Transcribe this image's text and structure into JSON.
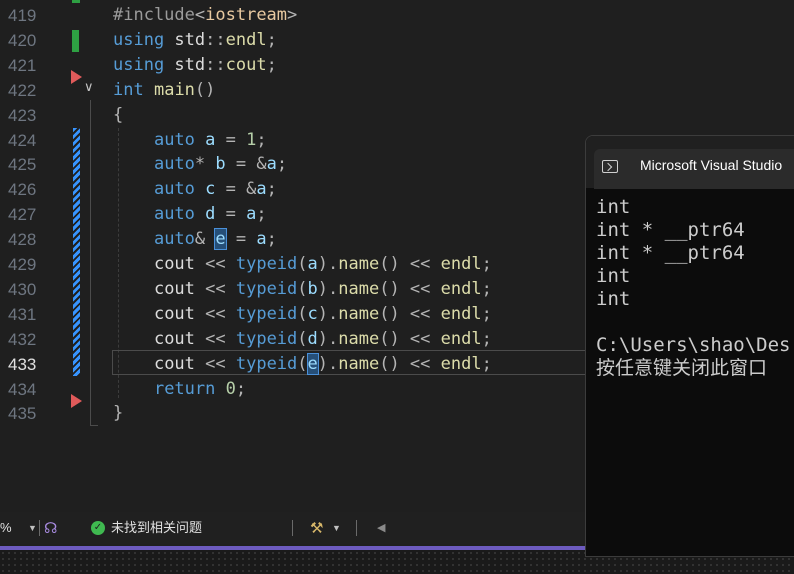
{
  "editor": {
    "lines": [
      {
        "num": "419",
        "tokens": [
          [
            "pp",
            "#include"
          ],
          [
            "op",
            "<"
          ],
          [
            "inc",
            "iostream"
          ],
          [
            "op",
            ">"
          ]
        ]
      },
      {
        "num": "420",
        "tokens": [
          [
            "kw",
            "using"
          ],
          [
            "id",
            " std"
          ],
          [
            "op",
            "::"
          ],
          [
            "fn",
            "endl"
          ],
          [
            "op",
            ";"
          ]
        ]
      },
      {
        "num": "421",
        "tokens": [
          [
            "kw",
            "using"
          ],
          [
            "id",
            " std"
          ],
          [
            "op",
            "::"
          ],
          [
            "fn",
            "cout"
          ],
          [
            "op",
            ";"
          ]
        ]
      },
      {
        "num": "422",
        "tokens": [
          [
            "kw",
            "int"
          ],
          [
            "id",
            " "
          ],
          [
            "fn",
            "main"
          ],
          [
            "op",
            "()"
          ]
        ]
      },
      {
        "num": "423",
        "tokens": [
          [
            "op",
            "{"
          ]
        ]
      },
      {
        "num": "424",
        "tokens": [
          [
            "id",
            "    "
          ],
          [
            "kw",
            "auto"
          ],
          [
            "id",
            " "
          ],
          [
            "var",
            "a"
          ],
          [
            "op",
            " = "
          ],
          [
            "num",
            "1"
          ],
          [
            "op",
            ";"
          ]
        ]
      },
      {
        "num": "425",
        "tokens": [
          [
            "id",
            "    "
          ],
          [
            "kw",
            "auto"
          ],
          [
            "op",
            "*"
          ],
          [
            "id",
            " "
          ],
          [
            "var",
            "b"
          ],
          [
            "op",
            " = &"
          ],
          [
            "var",
            "a"
          ],
          [
            "op",
            ";"
          ]
        ]
      },
      {
        "num": "426",
        "tokens": [
          [
            "id",
            "    "
          ],
          [
            "kw",
            "auto"
          ],
          [
            "id",
            " "
          ],
          [
            "var",
            "c"
          ],
          [
            "op",
            " = &"
          ],
          [
            "var",
            "a"
          ],
          [
            "op",
            ";"
          ]
        ]
      },
      {
        "num": "427",
        "tokens": [
          [
            "id",
            "    "
          ],
          [
            "kw",
            "auto"
          ],
          [
            "id",
            " "
          ],
          [
            "var",
            "d"
          ],
          [
            "op",
            " = "
          ],
          [
            "var",
            "a"
          ],
          [
            "op",
            ";"
          ]
        ]
      },
      {
        "num": "428",
        "tokens": [
          [
            "id",
            "    "
          ],
          [
            "kw",
            "auto"
          ],
          [
            "op",
            "&"
          ],
          [
            "id",
            " "
          ],
          [
            "varhl",
            "e"
          ],
          [
            "op",
            " = "
          ],
          [
            "var",
            "a"
          ],
          [
            "op",
            ";"
          ]
        ]
      },
      {
        "num": "429",
        "tokens": [
          [
            "id",
            "    "
          ],
          [
            "id",
            "cout"
          ],
          [
            "op",
            " << "
          ],
          [
            "kw",
            "typeid"
          ],
          [
            "op",
            "("
          ],
          [
            "var",
            "a"
          ],
          [
            "op",
            ")."
          ],
          [
            "fn",
            "name"
          ],
          [
            "op",
            "() << "
          ],
          [
            "fn",
            "endl"
          ],
          [
            "op",
            ";"
          ]
        ]
      },
      {
        "num": "430",
        "tokens": [
          [
            "id",
            "    "
          ],
          [
            "id",
            "cout"
          ],
          [
            "op",
            " << "
          ],
          [
            "kw",
            "typeid"
          ],
          [
            "op",
            "("
          ],
          [
            "var",
            "b"
          ],
          [
            "op",
            ")."
          ],
          [
            "fn",
            "name"
          ],
          [
            "op",
            "() << "
          ],
          [
            "fn",
            "endl"
          ],
          [
            "op",
            ";"
          ]
        ]
      },
      {
        "num": "431",
        "tokens": [
          [
            "id",
            "    "
          ],
          [
            "id",
            "cout"
          ],
          [
            "op",
            " << "
          ],
          [
            "kw",
            "typeid"
          ],
          [
            "op",
            "("
          ],
          [
            "var",
            "c"
          ],
          [
            "op",
            ")."
          ],
          [
            "fn",
            "name"
          ],
          [
            "op",
            "() << "
          ],
          [
            "fn",
            "endl"
          ],
          [
            "op",
            ";"
          ]
        ]
      },
      {
        "num": "432",
        "tokens": [
          [
            "id",
            "    "
          ],
          [
            "id",
            "cout"
          ],
          [
            "op",
            " << "
          ],
          [
            "kw",
            "typeid"
          ],
          [
            "op",
            "("
          ],
          [
            "var",
            "d"
          ],
          [
            "op",
            ")."
          ],
          [
            "fn",
            "name"
          ],
          [
            "op",
            "() << "
          ],
          [
            "fn",
            "endl"
          ],
          [
            "op",
            ";"
          ]
        ]
      },
      {
        "num": "433",
        "current": true,
        "tokens": [
          [
            "id",
            "    "
          ],
          [
            "id",
            "cout"
          ],
          [
            "op",
            " << "
          ],
          [
            "kw",
            "typeid"
          ],
          [
            "op",
            "("
          ],
          [
            "varhl",
            "e"
          ],
          [
            "op",
            ")."
          ],
          [
            "fn",
            "name"
          ],
          [
            "op",
            "() << "
          ],
          [
            "fn",
            "endl"
          ],
          [
            "op",
            ";"
          ]
        ]
      },
      {
        "num": "434",
        "tokens": [
          [
            "id",
            "    "
          ],
          [
            "kw",
            "return"
          ],
          [
            "id",
            " "
          ],
          [
            "num",
            "0"
          ],
          [
            "op",
            ";"
          ]
        ]
      },
      {
        "num": "435",
        "tokens": [
          [
            "op",
            "}"
          ]
        ]
      }
    ]
  },
  "status": {
    "zoom": "%",
    "issues_text": "未找到相关问题"
  },
  "console": {
    "title": "Microsoft Visual Studio",
    "output": [
      "int",
      "int * __ptr64",
      "int * __ptr64",
      "int",
      "int",
      "",
      "C:\\Users\\shao\\Des",
      "按任意键关闭此窗口"
    ]
  },
  "colors": {
    "keyword": "#569cd6",
    "function": "#dcdcaa",
    "variable": "#9cdcfe",
    "number": "#b5cea8",
    "change_saved": "#2ea043",
    "change_unsaved": "#3794ff",
    "breakpoint_arrow": "#e05a5a",
    "console_bg": "#0c0c0c"
  }
}
